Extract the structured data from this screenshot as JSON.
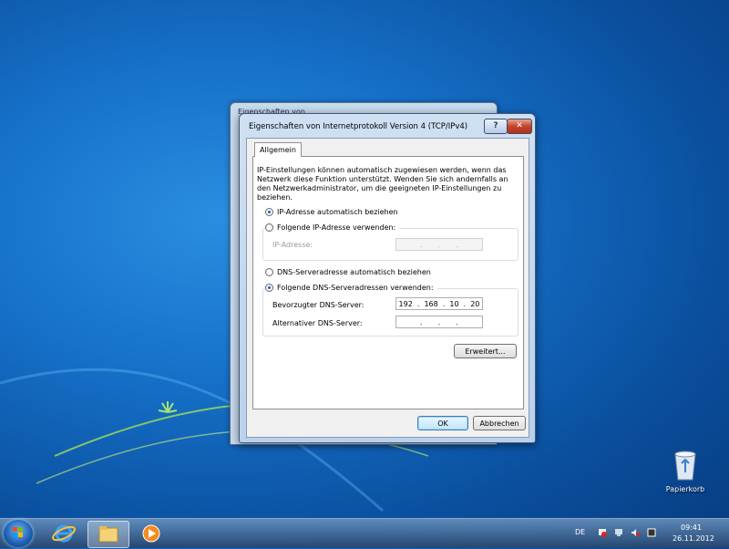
{
  "background_window": {
    "title": "Eigenschaften von ..."
  },
  "dialog": {
    "title": "Eigenschaften von Internetprotokoll Version 4 (TCP/IPv4)",
    "help_label": "?",
    "close_label": "✕",
    "tab_label": "Allgemein",
    "info_text": "IP-Einstellungen können automatisch zugewiesen werden, wenn das Netzwerk diese Funktion unterstützt. Wenden Sie sich andernfalls an den Netzwerkadministrator, um die geeigneten IP-Einstellungen zu beziehen.",
    "ip_auto_label": "IP-Adresse automatisch beziehen",
    "ip_manual_label": "Folgende IP-Adresse verwenden:",
    "ip_address_label": "IP-Adresse:",
    "ip_address_value": [
      ".",
      ".",
      "."
    ],
    "dns_auto_label": "DNS-Serveradresse automatisch beziehen",
    "dns_manual_label": "Folgende DNS-Serveradressen verwenden:",
    "preferred_dns_label": "Bevorzugter DNS-Server:",
    "preferred_dns_octets": [
      "192",
      "168",
      "10",
      "20"
    ],
    "alternate_dns_label": "Alternativer DNS-Server:",
    "alternate_dns_value": [
      ".",
      ".",
      "."
    ],
    "advanced_label": "Erweitert...",
    "ok_label": "OK",
    "cancel_label": "Abbrechen",
    "ip_auto_selected": true,
    "dns_manual_selected": true
  },
  "desktop": {
    "recycle_bin_label": "Papierkorb"
  },
  "taskbar": {
    "language": "DE",
    "time": "09:41",
    "date": "26.11.2012",
    "pinned": [
      "start-orb",
      "internet-explorer-icon",
      "explorer-folder-icon",
      "media-player-icon"
    ]
  },
  "colors": {
    "accent": "#1670c8",
    "close_red": "#c4442a"
  }
}
